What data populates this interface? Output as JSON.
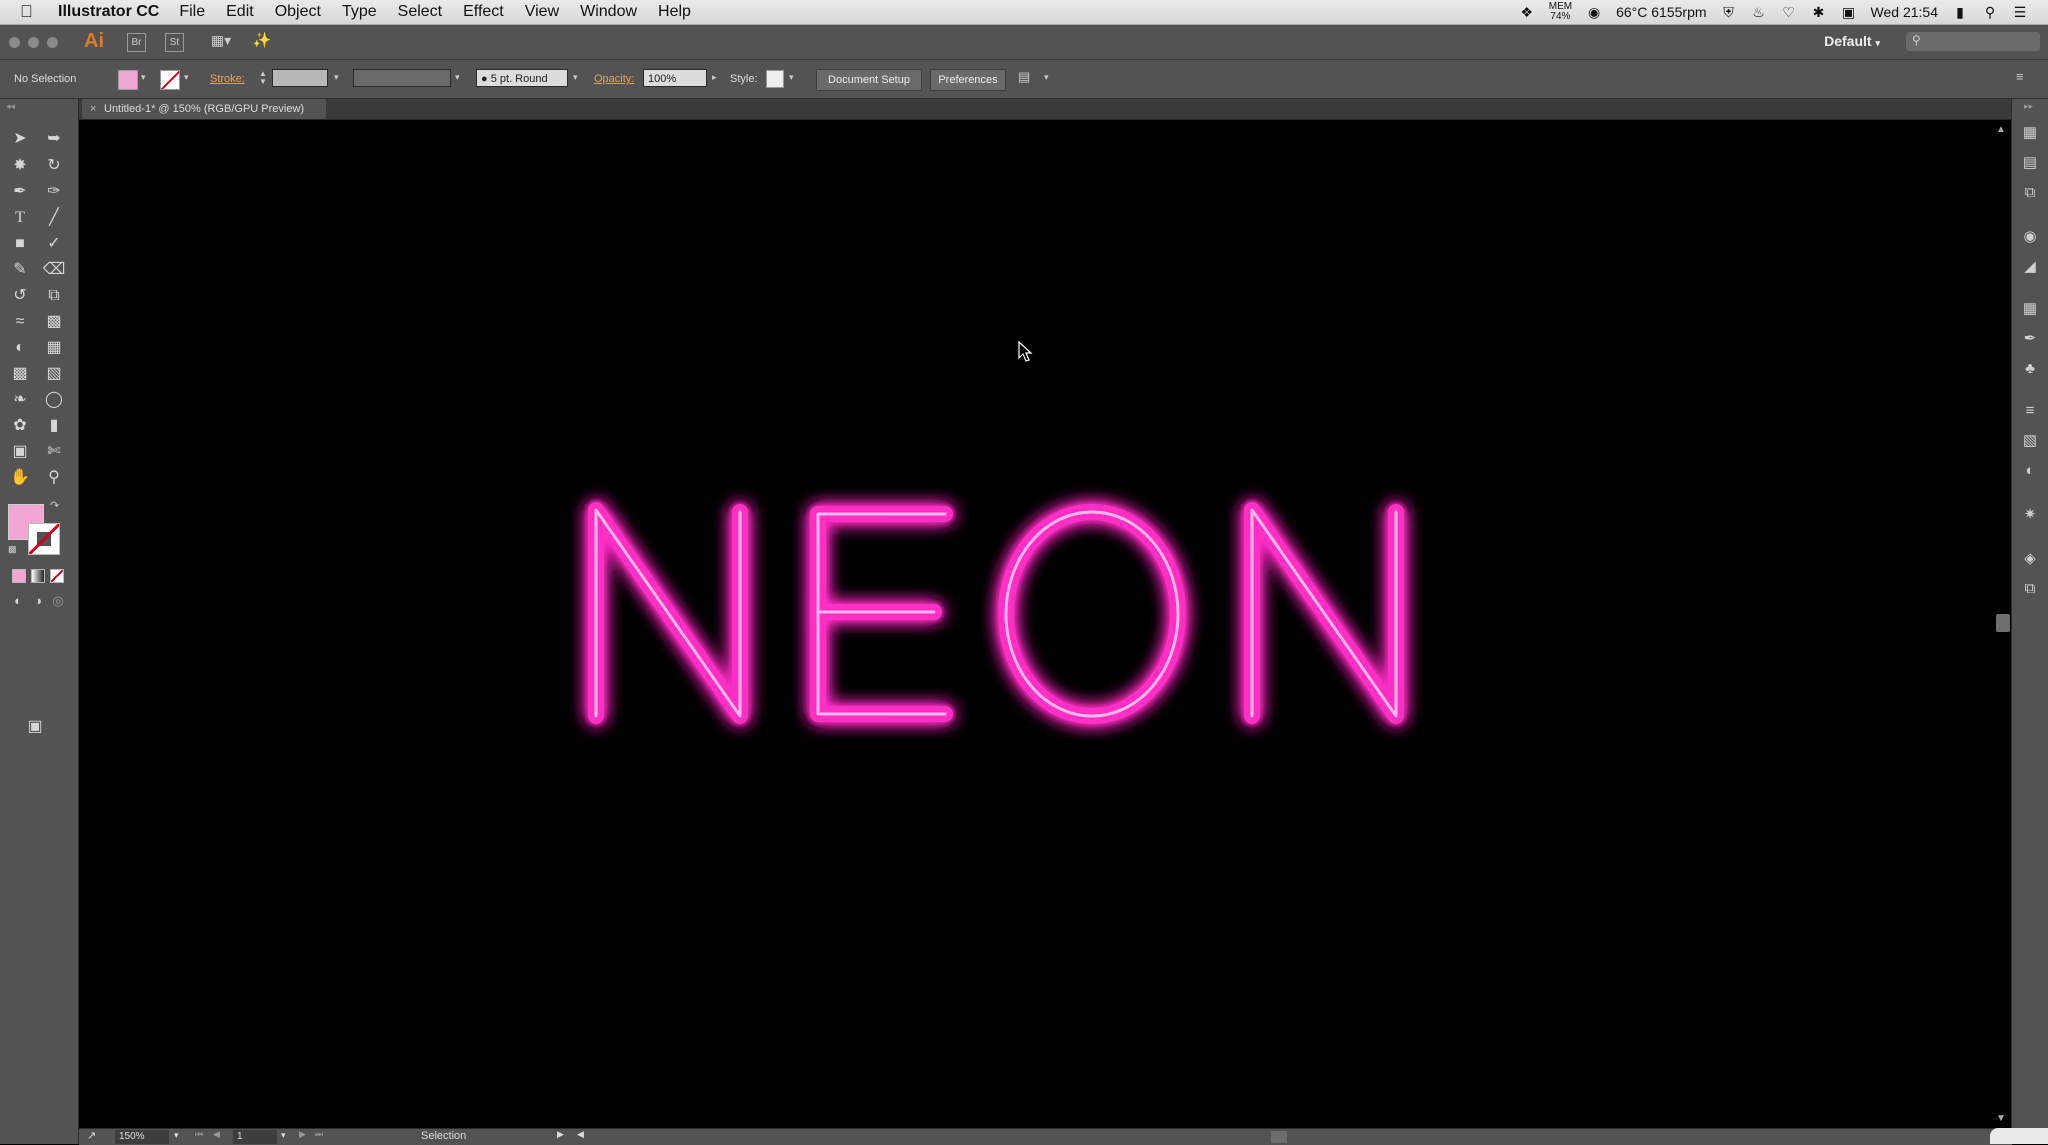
{
  "menubar": {
    "app_name": "Illustrator CC",
    "items": [
      "File",
      "Edit",
      "Object",
      "Type",
      "Select",
      "Effect",
      "View",
      "Window",
      "Help"
    ],
    "status": {
      "mem_label": "MEM",
      "mem_value": "74%",
      "temperature": "66°C 6155rpm",
      "clock": "Wed 21:54"
    }
  },
  "appbar": {
    "logo": "Ai",
    "bridge_label": "Br",
    "stock_label": "St",
    "workspace": "Default"
  },
  "control": {
    "selection_state": "No Selection",
    "fill_color": "#f2a6d4",
    "stroke_label": "Stroke:",
    "brush": "5 pt. Round",
    "opacity_label": "Opacity:",
    "opacity_value": "100%",
    "style_label": "Style:",
    "document_setup": "Document Setup",
    "preferences": "Preferences"
  },
  "document": {
    "tab_title": "Untitled-1* @ 150% (RGB/GPU Preview)",
    "canvas_text": "NEON",
    "neon_color": "#ff2fc4",
    "background": "#000000"
  },
  "status": {
    "zoom": "150%",
    "artboard": "1",
    "tool": "Selection"
  },
  "tools": [
    "selection-tool-icon",
    "direct-selection-tool-icon",
    "magic-wand-tool-icon",
    "lasso-tool-icon",
    "pen-tool-icon",
    "curvature-tool-icon",
    "type-tool-icon",
    "line-segment-tool-icon",
    "rectangle-tool-icon",
    "paintbrush-tool-icon",
    "shaper-tool-icon",
    "eraser-tool-icon",
    "rotate-tool-icon",
    "scale-tool-icon",
    "width-tool-icon",
    "free-transform-tool-icon",
    "shape-builder-tool-icon",
    "perspective-grid-tool-icon",
    "mesh-tool-icon",
    "gradient-tool-icon",
    "eyedropper-tool-icon",
    "blend-tool-icon",
    "symbol-sprayer-tool-icon",
    "column-graph-tool-icon",
    "artboard-tool-icon",
    "slice-tool-icon",
    "hand-tool-icon",
    "zoom-tool-icon"
  ]
}
